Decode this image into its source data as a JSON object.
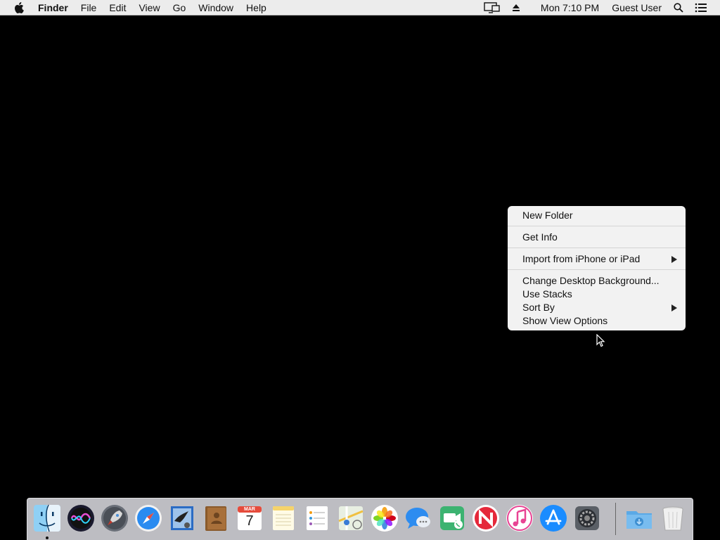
{
  "menubar": {
    "app_name": "Finder",
    "menus": [
      "File",
      "Edit",
      "View",
      "Go",
      "Window",
      "Help"
    ],
    "clock": "Mon 7:10 PM",
    "user": "Guest User",
    "icons": [
      "apple-icon",
      "display-mirroring-icon",
      "eject-icon",
      "spotlight-search-icon",
      "notification-center-icon"
    ]
  },
  "context_menu": {
    "items": [
      {
        "label": "New Folder"
      },
      {
        "label": "Get Info"
      },
      {
        "label": "Import from iPhone or iPad",
        "submenu": true
      },
      {
        "label": "Change Desktop Background..."
      },
      {
        "label": "Use Stacks"
      },
      {
        "label": "Sort By",
        "submenu": true
      },
      {
        "label": "Show View Options"
      }
    ]
  },
  "dock": {
    "calendar_month": "MAR",
    "calendar_day": "7",
    "apps": [
      "Finder",
      "Siri",
      "Launchpad",
      "Safari",
      "Mail",
      "Contacts",
      "Calendar",
      "Notes",
      "Reminders",
      "Maps",
      "Photos",
      "Messages",
      "FaceTime",
      "News",
      "iTunes",
      "App Store",
      "System Preferences",
      "Downloads",
      "Trash"
    ]
  },
  "colors": {
    "desktop": "#000000",
    "menubar": "#ececec",
    "menu_bg": "#f2f2f2",
    "dock_bg": "#cdcdd2"
  }
}
